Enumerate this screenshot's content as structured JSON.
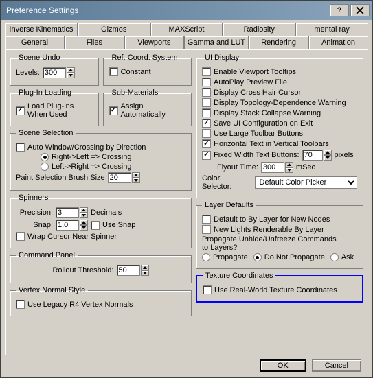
{
  "window": {
    "title": "Preference Settings"
  },
  "tabs_row1": [
    "Inverse Kinematics",
    "Gizmos",
    "MAXScript",
    "Radiosity",
    "mental ray"
  ],
  "tabs_row2": [
    "General",
    "Files",
    "Viewports",
    "Gamma and LUT",
    "Rendering",
    "Animation"
  ],
  "active_tab": "General",
  "left": {
    "scene_undo": {
      "legend": "Scene Undo",
      "levels_label": "Levels:",
      "levels_value": "300"
    },
    "ref_coord": {
      "legend": "Ref. Coord. System",
      "constant_label": "Constant",
      "constant_checked": false
    },
    "plugin": {
      "legend": "Plug-In Loading",
      "load_label": "Load Plug-ins\nWhen Used",
      "load_checked": true
    },
    "submat": {
      "legend": "Sub-Materials",
      "assign_label": "Assign\nAutomatically",
      "assign_checked": true
    },
    "scene_sel": {
      "legend": "Scene Selection",
      "auto_label": "Auto Window/Crossing by Direction",
      "auto_checked": false,
      "opt1_label": "Right->Left => Crossing",
      "opt2_label": "Left->Right => Crossing",
      "opt_selected": 0,
      "brush_label": "Paint Selection Brush Size",
      "brush_value": "20"
    },
    "spinners": {
      "legend": "Spinners",
      "precision_label": "Precision:",
      "precision_value": "3",
      "decimals_label": "Decimals",
      "snap_label": "Snap:",
      "snap_value": "1.0",
      "use_snap_label": "Use Snap",
      "use_snap_checked": false,
      "wrap_label": "Wrap Cursor Near Spinner",
      "wrap_checked": false
    },
    "cmd_panel": {
      "legend": "Command Panel",
      "rollout_label": "Rollout Threshold:",
      "rollout_value": "50"
    },
    "vertex_normal": {
      "legend": "Vertex Normal Style",
      "legacy_label": "Use Legacy R4 Vertex Normals",
      "legacy_checked": false
    }
  },
  "right": {
    "ui_display": {
      "legend": "UI Display",
      "items": [
        {
          "label": "Enable Viewport Tooltips",
          "checked": false
        },
        {
          "label": "AutoPlay Preview File",
          "checked": false
        },
        {
          "label": "Display Cross Hair Cursor",
          "checked": false
        },
        {
          "label": "Display Topology-Dependence Warning",
          "checked": false
        },
        {
          "label": "Display Stack Collapse Warning",
          "checked": false
        },
        {
          "label": "Save UI Configuration on Exit",
          "checked": true
        },
        {
          "label": "Use Large Toolbar Buttons",
          "checked": false
        },
        {
          "label": "Horizontal Text in Vertical Toolbars",
          "checked": true
        }
      ],
      "fixed_width_label": "Fixed Width Text Buttons:",
      "fixed_width_checked": true,
      "fixed_width_value": "70",
      "pixels_label": "pixels",
      "flyout_label": "Flyout Time:",
      "flyout_value": "300",
      "msec_label": "mSec",
      "color_sel_label": "Color Selector:",
      "color_sel_value": "Default Color Picker"
    },
    "layer_defaults": {
      "legend": "Layer Defaults",
      "default_by_layer_label": "Default to By Layer for New Nodes",
      "default_by_layer_checked": false,
      "new_lights_label": "New Lights Renderable By Layer",
      "new_lights_checked": false,
      "propagate_q": "Propagate Unhide/Unfreeze Commands\nto Layers?",
      "opt_propagate": "Propagate",
      "opt_donot": "Do Not Propagate",
      "opt_ask": "Ask",
      "propagate_selected": 1
    },
    "tex_coords": {
      "legend": "Texture Coordinates",
      "realworld_label": "Use Real-World Texture Coordinates",
      "realworld_checked": false
    }
  },
  "buttons": {
    "ok": "OK",
    "cancel": "Cancel"
  }
}
